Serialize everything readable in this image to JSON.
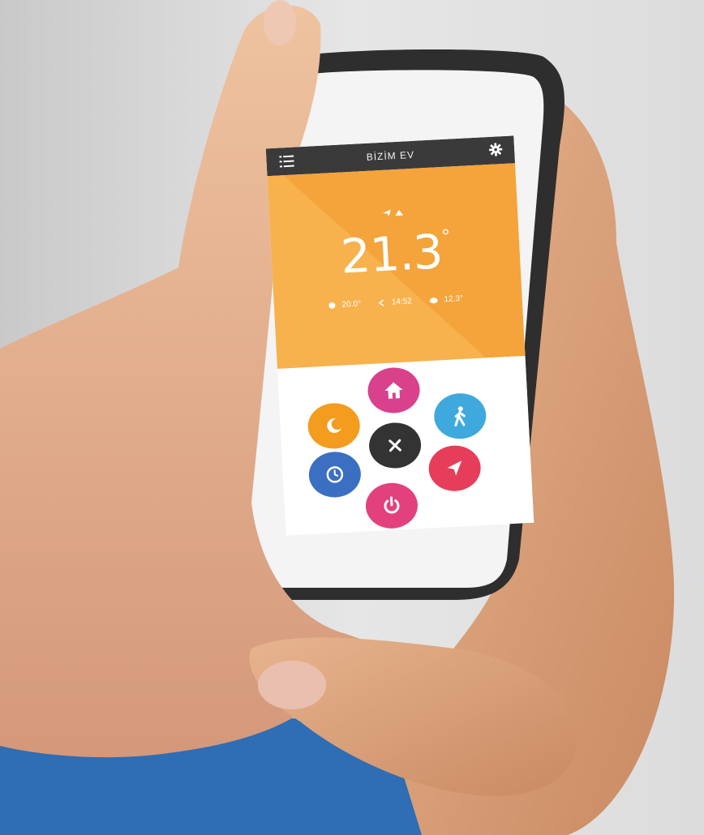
{
  "app": {
    "title": "BİZİM EV",
    "temperature": "21.3",
    "temperature_unit": "°",
    "set_point": "20.0°",
    "time": "14:52",
    "outdoor": "12.3°"
  },
  "colors": {
    "header": "#3a3a3a",
    "orange": "#f4a43a",
    "home": "#d9418d",
    "away": "#3fa9dd",
    "location": "#e63e5a",
    "power": "#e2417e",
    "schedule": "#3b6fc2",
    "night": "#f39c1e",
    "close": "#333333"
  },
  "icons": [
    "menu-icon",
    "gear-icon",
    "home-icon",
    "walking-icon",
    "location-arrow-icon",
    "power-icon",
    "clock-icon",
    "moon-icon",
    "close-icon"
  ]
}
